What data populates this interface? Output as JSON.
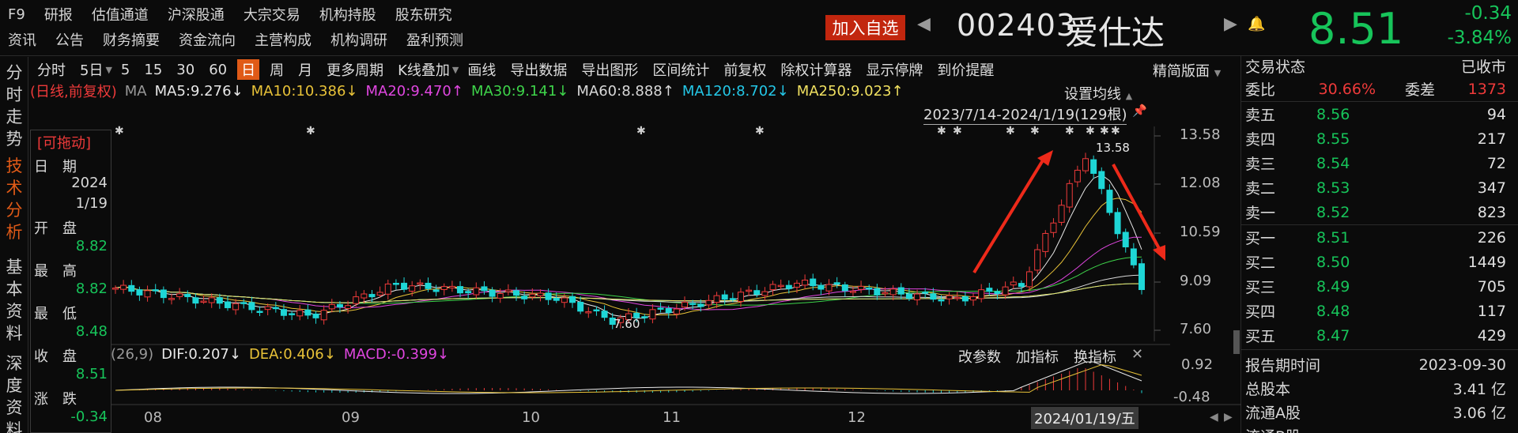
{
  "nav": {
    "row1": [
      "F9",
      "研报",
      "估值通道",
      "沪深股通",
      "大宗交易",
      "机构持股",
      "股东研究"
    ],
    "row2": [
      "资讯",
      "公告",
      "财务摘要",
      "资金流向",
      "主营构成",
      "机构调研",
      "盈利预测"
    ]
  },
  "header": {
    "add_watch": "加入自选",
    "prev_arrow": "◀",
    "next_arrow": "▶",
    "bell": "🔔",
    "code": "002403",
    "name": "爱仕达",
    "price": "8.51",
    "change": "-0.34",
    "change_pct": "-3.84%"
  },
  "leftbar": [
    "分时走势",
    "技术分析",
    "基本资料",
    "深度资料"
  ],
  "toolbar": {
    "items": [
      "分时",
      "5日",
      "5",
      "15",
      "30",
      "60",
      "日",
      "周",
      "月",
      "更多周期",
      "K线叠加",
      "画线",
      "导出数据",
      "导出图形",
      "区间统计",
      "前复权",
      "除权计算器",
      "显示停牌",
      "到价提醒"
    ],
    "active": "日",
    "layout_label": "精简版面"
  },
  "ma_legend": {
    "mode": "(日线,前复权)",
    "ma": "MA",
    "items": [
      {
        "text": "MA5:9.276↓",
        "color": "#e8e8e8"
      },
      {
        "text": "MA10:10.386↓",
        "color": "#e8c238"
      },
      {
        "text": "MA20:9.470↑",
        "color": "#e046e0"
      },
      {
        "text": "MA30:9.141↓",
        "color": "#3ed44a"
      },
      {
        "text": "MA60:8.888↑",
        "color": "#d8d8d8"
      },
      {
        "text": "MA120:8.702↓",
        "color": "#24c8e8"
      },
      {
        "text": "MA250:9.023↑",
        "color": "#f0e060"
      }
    ]
  },
  "chart_settings": {
    "set_ma": "设置均线",
    "range": "2023/7/14-2024/1/19(129根)",
    "high_label": "13.58",
    "low_label": "7.60",
    "y_ticks": [
      "13.58",
      "12.08",
      "10.59",
      "9.09",
      "7.60"
    ],
    "x_ticks": [
      "08",
      "09",
      "10",
      "11",
      "12"
    ],
    "cursor_date": "2024/01/19/五"
  },
  "infobox": {
    "drag": "[可拖动]",
    "date_label": "日　期",
    "year": "2024",
    "md": "1/19",
    "open_label": "开　盘",
    "open": "8.82",
    "high_label": "最　高",
    "high": "8.82",
    "low_label": "最　低",
    "low": "8.48",
    "close_label": "收　盘",
    "close": "8.51",
    "chg_label": "涨　跌",
    "chg": "-0.34"
  },
  "macd": {
    "params": "(26,9)",
    "dif": "DIF:0.207↓",
    "dea": "DEA:0.406↓",
    "macd": "MACD:-0.399↓",
    "buttons": [
      "改参数",
      "加指标",
      "换指标"
    ],
    "close": "✕",
    "y_ticks": [
      "0.92",
      "-0.48"
    ]
  },
  "orderbook": {
    "status_label": "交易状态",
    "status": "已收市",
    "wb_label": "委比",
    "wb": "30.66%",
    "wc_label": "委差",
    "wc": "1373",
    "asks": [
      {
        "label": "卖五",
        "price": "8.56",
        "vol": "94"
      },
      {
        "label": "卖四",
        "price": "8.55",
        "vol": "217"
      },
      {
        "label": "卖三",
        "price": "8.54",
        "vol": "72"
      },
      {
        "label": "卖二",
        "price": "8.53",
        "vol": "347"
      },
      {
        "label": "卖一",
        "price": "8.52",
        "vol": "823"
      }
    ],
    "bids": [
      {
        "label": "买一",
        "price": "8.51",
        "vol": "226"
      },
      {
        "label": "买二",
        "price": "8.50",
        "vol": "1449"
      },
      {
        "label": "买三",
        "price": "8.49",
        "vol": "705"
      },
      {
        "label": "买四",
        "price": "8.48",
        "vol": "117"
      },
      {
        "label": "买五",
        "price": "8.47",
        "vol": "429"
      }
    ]
  },
  "fundamentals": [
    {
      "label": "报告期时间",
      "value": "2023-09-30"
    },
    {
      "label": "总股本",
      "value": "3.41 亿"
    },
    {
      "label": "流通A股",
      "value": "3.06 亿"
    },
    {
      "label": "流通B股",
      "value": ""
    }
  ],
  "colors": {
    "up": "#ee3a3a",
    "down": "#1ed6d6",
    "accent": "#e05a17",
    "green": "#17c45a"
  }
}
